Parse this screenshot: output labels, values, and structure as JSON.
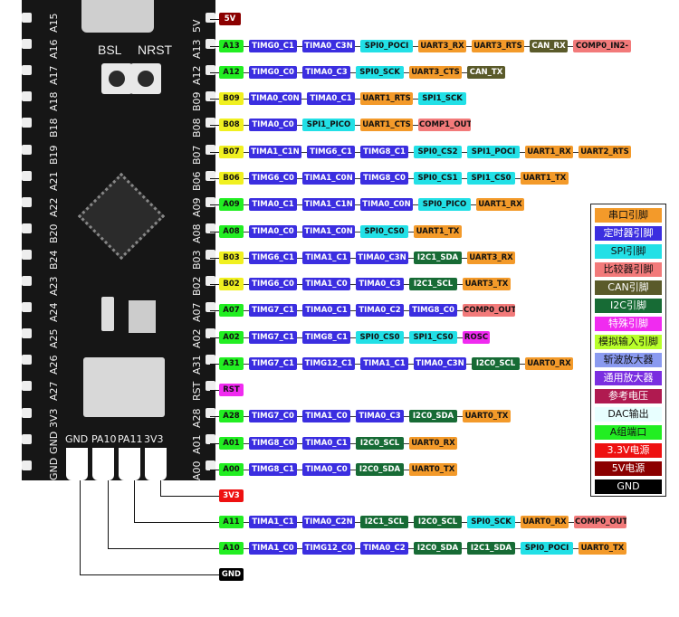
{
  "colors": {
    "uart": "#f39a2a",
    "timer": "#3b2ee0",
    "spi": "#22e0e6",
    "comp": "#f27a7a",
    "can": "#5a5a2a",
    "i2c": "#176b35",
    "special": "#f02bf0",
    "analog": "#b8ff2a",
    "chop": "#8a9af0",
    "opamp": "#7a2ee0",
    "vref": "#b01a50",
    "dac": "#e8ffff",
    "agroup": "#22ee22",
    "p33": "#ee1111",
    "p5": "#8b0000",
    "gnd": "#000000",
    "bgroup": "#f0f020"
  },
  "board": {
    "left_pins": [
      "A15",
      "A16",
      "A17",
      "A18",
      "B18",
      "B19",
      "A21",
      "A22",
      "B20",
      "B24",
      "A23",
      "A24",
      "A25",
      "A26",
      "A27",
      "3V3",
      "GND",
      "GND"
    ],
    "right_pins": [
      "5V",
      "A13",
      "A12",
      "B09",
      "B08",
      "B07",
      "B06",
      "A09",
      "A08",
      "B03",
      "B02",
      "A07",
      "A02",
      "A31",
      "RST",
      "A28",
      "A01",
      "A00"
    ],
    "buttons": [
      "BSL",
      "NRST"
    ],
    "bottom_pins": [
      "GND",
      "PA10",
      "PA11",
      "3V3"
    ]
  },
  "rows": [
    {
      "pin": "5V",
      "pin_color": "p5",
      "tags": []
    },
    {
      "pin": "A13",
      "pin_color": "agroup",
      "tags": [
        {
          "t": "TIMG0_C1",
          "c": "timer"
        },
        {
          "t": "TIMA0_C3N",
          "c": "timer"
        },
        {
          "t": "SPI0_POCI",
          "c": "spi"
        },
        {
          "t": "UART3_RX",
          "c": "uart"
        },
        {
          "t": "UART3_RTS",
          "c": "uart"
        },
        {
          "t": "CAN_RX",
          "c": "can"
        },
        {
          "t": "COMP0_IN2-",
          "c": "comp"
        }
      ]
    },
    {
      "pin": "A12",
      "pin_color": "agroup",
      "tags": [
        {
          "t": "TIMG0_C0",
          "c": "timer"
        },
        {
          "t": "TIMA0_C3",
          "c": "timer"
        },
        {
          "t": "SPI0_SCK",
          "c": "spi"
        },
        {
          "t": "UART3_CTS",
          "c": "uart"
        },
        {
          "t": "CAN_TX",
          "c": "can"
        }
      ]
    },
    {
      "pin": "B09",
      "pin_color": "bgroup",
      "tags": [
        {
          "t": "TIMA0_C0N",
          "c": "timer"
        },
        {
          "t": "TIMA0_C1",
          "c": "timer"
        },
        {
          "t": "UART1_RTS",
          "c": "uart"
        },
        {
          "t": "SPI1_SCK",
          "c": "spi"
        }
      ]
    },
    {
      "pin": "B08",
      "pin_color": "bgroup",
      "tags": [
        {
          "t": "TIMA0_C0",
          "c": "timer"
        },
        {
          "t": "SPI1_PICO",
          "c": "spi"
        },
        {
          "t": "UART1_CTS",
          "c": "uart"
        },
        {
          "t": "COMP1_OUT",
          "c": "comp"
        }
      ]
    },
    {
      "pin": "B07",
      "pin_color": "bgroup",
      "tags": [
        {
          "t": "TIMA1_C1N",
          "c": "timer"
        },
        {
          "t": "TIMG6_C1",
          "c": "timer"
        },
        {
          "t": "TIMG8_C1",
          "c": "timer"
        },
        {
          "t": "SPI0_CS2",
          "c": "spi"
        },
        {
          "t": "SPI1_POCI",
          "c": "spi"
        },
        {
          "t": "UART1_RX",
          "c": "uart"
        },
        {
          "t": "UART2_RTS",
          "c": "uart"
        }
      ]
    },
    {
      "pin": "B06",
      "pin_color": "bgroup",
      "tags": [
        {
          "t": "TIMG6_C0",
          "c": "timer"
        },
        {
          "t": "TIMA1_C0N",
          "c": "timer"
        },
        {
          "t": "TIMG8_C0",
          "c": "timer"
        },
        {
          "t": "SPI0_CS1",
          "c": "spi"
        },
        {
          "t": "SPI1_CS0",
          "c": "spi"
        },
        {
          "t": "UART1_TX",
          "c": "uart"
        }
      ]
    },
    {
      "pin": "A09",
      "pin_color": "agroup",
      "tags": [
        {
          "t": "TIMA0_C1",
          "c": "timer"
        },
        {
          "t": "TIMA1_C1N",
          "c": "timer"
        },
        {
          "t": "TIMA0_C0N",
          "c": "timer"
        },
        {
          "t": "SPI0_PICO",
          "c": "spi"
        },
        {
          "t": "UART1_RX",
          "c": "uart"
        }
      ]
    },
    {
      "pin": "A08",
      "pin_color": "agroup",
      "tags": [
        {
          "t": "TIMA0_C0",
          "c": "timer"
        },
        {
          "t": "TIMA1_C0N",
          "c": "timer"
        },
        {
          "t": "SPI0_CS0",
          "c": "spi"
        },
        {
          "t": "UART1_TX",
          "c": "uart"
        }
      ]
    },
    {
      "pin": "B03",
      "pin_color": "bgroup",
      "tags": [
        {
          "t": "TIMG6_C1",
          "c": "timer"
        },
        {
          "t": "TIMA1_C1",
          "c": "timer"
        },
        {
          "t": "TIMA0_C3N",
          "c": "timer"
        },
        {
          "t": "I2C1_SDA",
          "c": "i2c"
        },
        {
          "t": "UART3_RX",
          "c": "uart"
        }
      ]
    },
    {
      "pin": "B02",
      "pin_color": "bgroup",
      "tags": [
        {
          "t": "TIMG6_C0",
          "c": "timer"
        },
        {
          "t": "TIMA1_C0",
          "c": "timer"
        },
        {
          "t": "TIMA0_C3",
          "c": "timer"
        },
        {
          "t": "I2C1_SCL",
          "c": "i2c"
        },
        {
          "t": "UART3_TX",
          "c": "uart"
        }
      ]
    },
    {
      "pin": "A07",
      "pin_color": "agroup",
      "tags": [
        {
          "t": "TIMG7_C1",
          "c": "timer"
        },
        {
          "t": "TIMA0_C1",
          "c": "timer"
        },
        {
          "t": "TIMA0_C2",
          "c": "timer"
        },
        {
          "t": "TIMG8_C0",
          "c": "timer"
        },
        {
          "t": "COMP0_OUT",
          "c": "comp"
        }
      ]
    },
    {
      "pin": "A02",
      "pin_color": "agroup",
      "tags": [
        {
          "t": "TIMG7_C1",
          "c": "timer"
        },
        {
          "t": "TIMG8_C1",
          "c": "timer"
        },
        {
          "t": "SPI0_CS0",
          "c": "spi"
        },
        {
          "t": "SPI1_CS0",
          "c": "spi"
        },
        {
          "t": "ROSC",
          "c": "special"
        }
      ]
    },
    {
      "pin": "A31",
      "pin_color": "agroup",
      "tags": [
        {
          "t": "TIMG7_C1",
          "c": "timer"
        },
        {
          "t": "TIMG12_C1",
          "c": "timer"
        },
        {
          "t": "TIMA1_C1",
          "c": "timer"
        },
        {
          "t": "TIMA0_C3N",
          "c": "timer"
        },
        {
          "t": "I2C0_SCL",
          "c": "i2c"
        },
        {
          "t": "UART0_RX",
          "c": "uart"
        }
      ]
    },
    {
      "pin": "RST",
      "pin_color": "special",
      "tags": []
    },
    {
      "pin": "A28",
      "pin_color": "agroup",
      "tags": [
        {
          "t": "TIMG7_C0",
          "c": "timer"
        },
        {
          "t": "TIMA1_C0",
          "c": "timer"
        },
        {
          "t": "TIMA0_C3",
          "c": "timer"
        },
        {
          "t": "I2C0_SDA",
          "c": "i2c"
        },
        {
          "t": "UART0_TX",
          "c": "uart"
        }
      ]
    },
    {
      "pin": "A01",
      "pin_color": "agroup",
      "tags": [
        {
          "t": "TIMG8_C0",
          "c": "timer"
        },
        {
          "t": "TIMA0_C1",
          "c": "timer"
        },
        {
          "t": "I2C0_SCL",
          "c": "i2c"
        },
        {
          "t": "UART0_RX",
          "c": "uart"
        }
      ]
    },
    {
      "pin": "A00",
      "pin_color": "agroup",
      "tags": [
        {
          "t": "TIMG8_C1",
          "c": "timer"
        },
        {
          "t": "TIMA0_C0",
          "c": "timer"
        },
        {
          "t": "I2C0_SDA",
          "c": "i2c"
        },
        {
          "t": "UART0_TX",
          "c": "uart"
        }
      ]
    },
    {
      "pin": "3V3",
      "pin_color": "p33",
      "tags": []
    },
    {
      "pin": "A11",
      "pin_color": "agroup",
      "tags": [
        {
          "t": "TIMA1_C1",
          "c": "timer"
        },
        {
          "t": "TIMA0_C2N",
          "c": "timer"
        },
        {
          "t": "I2C1_SCL",
          "c": "i2c"
        },
        {
          "t": "I2C0_SCL",
          "c": "i2c"
        },
        {
          "t": "SPI0_SCK",
          "c": "spi"
        },
        {
          "t": "UART0_RX",
          "c": "uart"
        },
        {
          "t": "COMP0_OUT",
          "c": "comp"
        }
      ]
    },
    {
      "pin": "A10",
      "pin_color": "agroup",
      "tags": [
        {
          "t": "TIMA1_C0",
          "c": "timer"
        },
        {
          "t": "TIMG12_C0",
          "c": "timer"
        },
        {
          "t": "TIMA0_C2",
          "c": "timer"
        },
        {
          "t": "I2C0_SDA",
          "c": "i2c"
        },
        {
          "t": "I2C1_SDA",
          "c": "i2c"
        },
        {
          "t": "SPI0_POCI",
          "c": "spi"
        },
        {
          "t": "UART0_TX",
          "c": "uart"
        }
      ]
    },
    {
      "pin": "GND",
      "pin_color": "gnd",
      "tags": []
    }
  ],
  "legend": [
    {
      "label": "串口引脚",
      "c": "uart"
    },
    {
      "label": "定时器引脚",
      "c": "timer"
    },
    {
      "label": "SPI引脚",
      "c": "spi"
    },
    {
      "label": "比较器引脚",
      "c": "comp"
    },
    {
      "label": "CAN引脚",
      "c": "can"
    },
    {
      "label": "I2C引脚",
      "c": "i2c"
    },
    {
      "label": "特殊引脚",
      "c": "special"
    },
    {
      "label": "模拟输入引脚",
      "c": "analog"
    },
    {
      "label": "斩波放大器",
      "c": "chop"
    },
    {
      "label": "通用放大器",
      "c": "opamp"
    },
    {
      "label": "参考电压",
      "c": "vref"
    },
    {
      "label": "DAC输出",
      "c": "dac"
    },
    {
      "label": "A组端口",
      "c": "agroup"
    },
    {
      "label": "3.3V电源",
      "c": "p33"
    },
    {
      "label": "5V电源",
      "c": "p5"
    },
    {
      "label": "GND",
      "c": "gnd"
    }
  ]
}
